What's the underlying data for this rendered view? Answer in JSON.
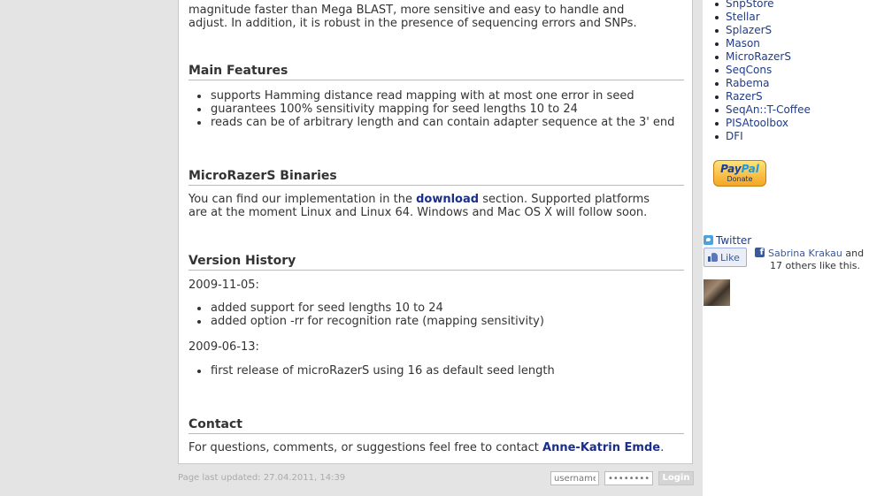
{
  "intro": {
    "line1": "magnitude faster than Mega BLAST, more sensitive and easy to handle and",
    "line2": "adjust. In addition, it is robust in the presence of sequencing errors and SNPs."
  },
  "main_features": {
    "heading": "Main Features",
    "items": [
      "supports Hamming distance read mapping with at most one error in seed",
      "guarantees 100% sensitivity mapping for seed lengths 10 to 24",
      "reads can be of arbitrary length and can contain adapter sequence at the 3' end"
    ]
  },
  "binaries": {
    "heading": "MicroRazerS Binaries",
    "text_before_link": "You can find our implementation in the ",
    "link": "download",
    "text_after_link": " section. Supported platforms",
    "line2": "are at the moment Linux and Linux 64. Windows and Mac OS X will follow soon."
  },
  "version_history": {
    "heading": "Version History",
    "entries": [
      {
        "date": "2009-11-05:",
        "items": [
          "added support for seed lengths 10 to 24",
          "added option -rr for recognition rate (mapping sensitivity)"
        ]
      },
      {
        "date": "2009-06-13:",
        "items": [
          "first release of microRazerS using 16 as default seed length"
        ]
      }
    ]
  },
  "contact": {
    "heading": "Contact",
    "text": "For questions, comments, or suggestions feel free to contact ",
    "link": "Anne-Katrin Emde",
    "end": "."
  },
  "sidebar": {
    "projects": [
      "SnpStore",
      "Stellar",
      "SplazerS",
      "Mason",
      "MicroRazerS",
      "SeqCons",
      "Rabema",
      "RazerS",
      "SeqAn::T-Coffee",
      "PISAtoolbox",
      "DFI"
    ],
    "paypal": {
      "brand_pay": "Pay",
      "brand_pal": "Pal",
      "label": "Donate"
    },
    "twitter": "Twitter",
    "like_label": "Like",
    "facebook": {
      "name": "Sabrina Krakau",
      "and": " and",
      "others": "17 others like this."
    }
  },
  "footer": {
    "last_updated": "Page last updated: 27.04.2011, 14:39",
    "username_placeholder": "username",
    "password_placeholder": "••••••••",
    "login_label": "Login"
  }
}
